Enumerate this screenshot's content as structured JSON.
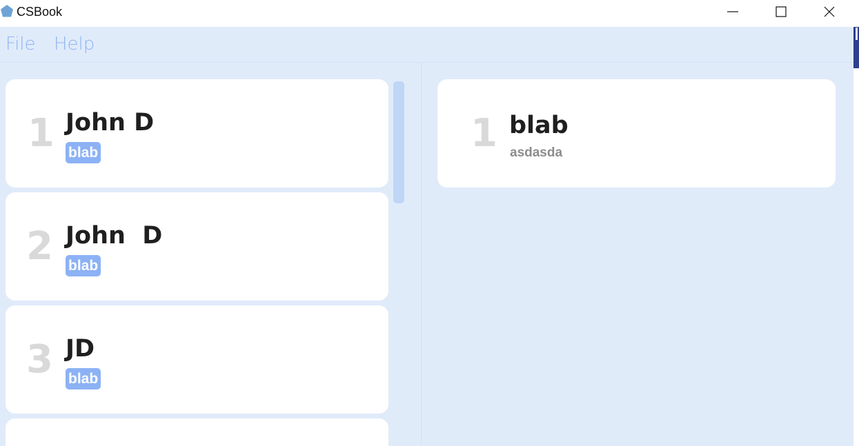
{
  "window": {
    "title": "CSBook",
    "icon": "pentagon-app-icon",
    "controls": [
      "minimize-icon",
      "maximize-icon",
      "close-icon"
    ]
  },
  "menu": {
    "items": [
      {
        "label": "File"
      },
      {
        "label": "Help"
      }
    ]
  },
  "people": [
    {
      "index": "1",
      "name": "John D",
      "tag": "blab"
    },
    {
      "index": "2",
      "name": "John  D",
      "tag": "blab"
    },
    {
      "index": "3",
      "name": "JD",
      "tag": "blab"
    }
  ],
  "detail": {
    "index": "1",
    "title": "blab",
    "subtitle": "asdasda"
  },
  "colors": {
    "background": "#e0ebfa",
    "menu_text": "#8fb5f3",
    "tag": "#8cb2f5",
    "index_number": "#d9d9d9"
  }
}
